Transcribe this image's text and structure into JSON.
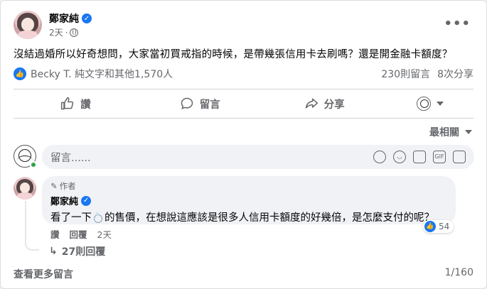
{
  "post": {
    "author": "鄭家純",
    "time": "2天",
    "text": "沒結過婚所以好奇想問，大家當初買戒指的時候，是帶幾張信用卡去刷嗎？還是開金融卡額度？",
    "more_icon": "more-dots-icon",
    "privacy_icon": "globe-icon"
  },
  "reactions": {
    "summary": "Becky T. 純文字和其他1,570人",
    "comments": "230則留言",
    "shares": "8次分享"
  },
  "actions": {
    "like": "讚",
    "comment": "留言",
    "share": "分享"
  },
  "sort": {
    "label": "最相關"
  },
  "composer": {
    "placeholder": "留言......"
  },
  "comment": {
    "author_tag": "作者",
    "author": "鄭家純",
    "text_before": "看了一下",
    "text_after": "的售價，在想說這應該是很多人信用卡額度的好幾倍，是怎麼支付的呢？",
    "like_count": "54",
    "like_label": "讚",
    "reply_label": "回覆",
    "time": "2天",
    "replies": "27則回覆"
  },
  "footer": {
    "more_comments": "查看更多留言",
    "pager": "1/160"
  },
  "colors": {
    "accent": "#1877f2",
    "muted": "#65676b",
    "online": "#31a24c"
  }
}
